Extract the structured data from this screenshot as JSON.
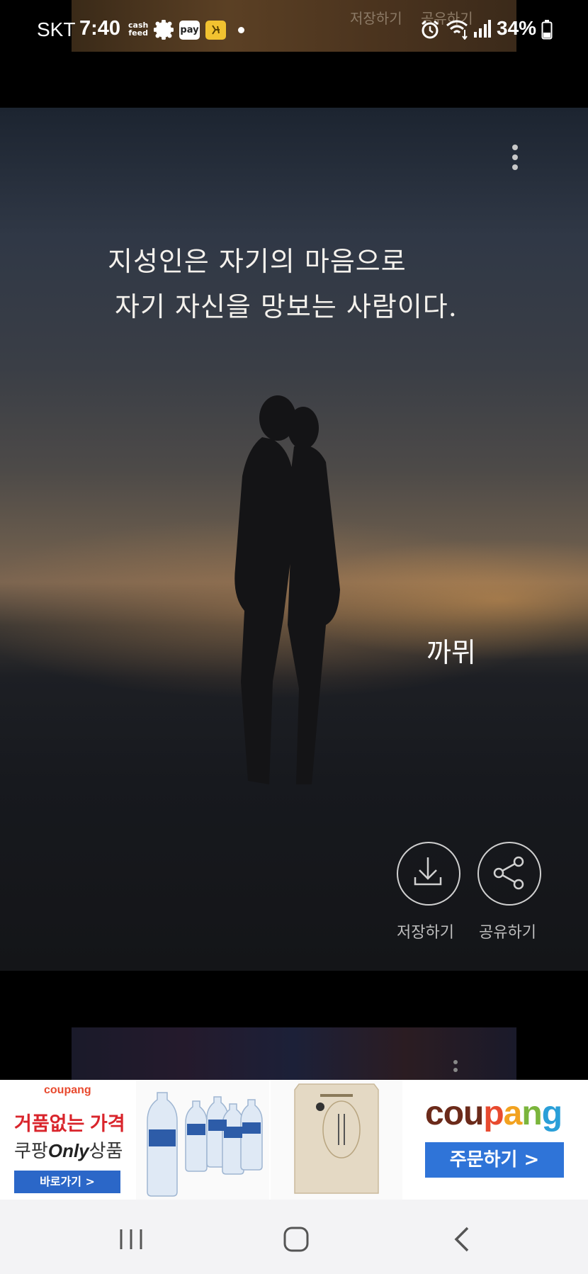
{
  "status_bar": {
    "carrier": "SKT",
    "time": "7:40",
    "cash_line1": "cash",
    "cash_line2": "feed",
    "pay_label": "pay",
    "battery_percent": "34%",
    "icons": [
      "gear-icon",
      "pay-icon",
      "kb-icon",
      "alarm-icon",
      "wifi-icon",
      "signal-icon",
      "battery-icon"
    ]
  },
  "peek_top": {
    "save_label": "저장하기",
    "share_label": "공유하기"
  },
  "card": {
    "quote_line1": "지성인은 자기의 마음으로",
    "quote_line2": "자기 자신을 망보는 사람이다.",
    "author": "까뮈",
    "save_label": "저장하기",
    "share_label": "공유하기"
  },
  "ad": {
    "promo_brand": "coupang",
    "promo_line1": "거품없는 가격",
    "promo_line2_prefix": "쿠팡",
    "promo_line2_emph": "Only",
    "promo_line2_suffix": "상품",
    "promo_button": "바로가기 >",
    "brand_logo": "coupang",
    "order_button": "주문하기 >",
    "colors": {
      "coupang_red": "#e84a2f",
      "coupang_blue": "#2f74d8"
    }
  },
  "nav": {
    "icons": [
      "recent-apps-icon",
      "home-icon",
      "back-icon"
    ]
  }
}
